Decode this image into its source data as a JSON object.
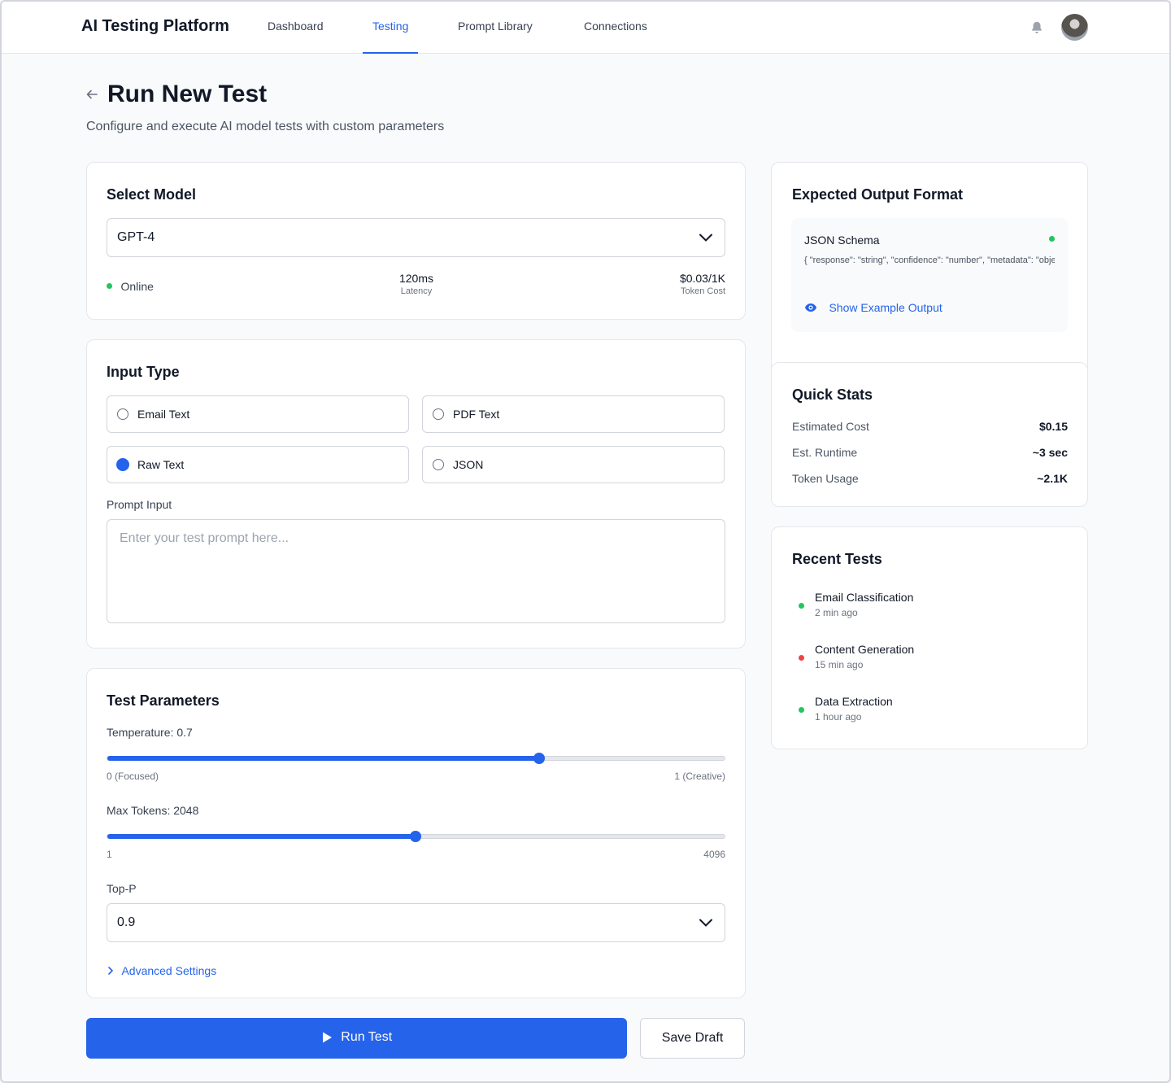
{
  "header": {
    "brand": "AI Testing Platform",
    "nav": [
      {
        "label": "Dashboard"
      },
      {
        "label": "Testing"
      },
      {
        "label": "Prompt Library"
      },
      {
        "label": "Connections"
      }
    ],
    "active_nav": "Testing",
    "notifications_icon": "bell-icon",
    "avatar_icon": "user-avatar"
  },
  "page": {
    "title": "Run New Test",
    "subtitle": "Configure and execute AI model tests with custom parameters",
    "back_icon": "arrow-left-icon"
  },
  "select_model": {
    "title": "Select Model",
    "selected": "GPT-4",
    "status": "Online",
    "status_color": "#22c55e",
    "latency_value": "120ms",
    "latency_label": "Latency",
    "cost_value": "$0.03/1K",
    "cost_label": "Token Cost"
  },
  "input_type": {
    "title": "Input Type",
    "options": [
      {
        "label": "Email Text",
        "checked": false
      },
      {
        "label": "PDF Text",
        "checked": false
      },
      {
        "label": "Raw Text",
        "checked": true
      },
      {
        "label": "JSON",
        "checked": false
      }
    ],
    "prompt_label": "Prompt Input",
    "prompt_placeholder": "Enter your test prompt here...",
    "prompt_value": ""
  },
  "test_parameters": {
    "title": "Test Parameters",
    "temperature": {
      "label": "Temperature: 0.7",
      "value": 0.7,
      "min": 0,
      "max": 1,
      "min_label": "0 (Focused)",
      "max_label": "1 (Creative)"
    },
    "max_tokens": {
      "label": "Max Tokens: 2048",
      "value": 2048,
      "min": 1,
      "max": 4096,
      "min_label": "1",
      "max_label": "4096"
    },
    "top_p": {
      "label": "Top-P",
      "selected": "0.9"
    },
    "advanced_link": "Advanced Settings"
  },
  "actions": {
    "run_label": "Run Test",
    "save_label": "Save Draft",
    "primary_color": "#2563eb"
  },
  "expected_output": {
    "title": "Expected Output Format",
    "schema_title": "JSON Schema",
    "schema_preview": "{ \"response\": \"string\", \"confidence\": \"number\", \"metadata\": \"object\" }",
    "status_color": "#22c55e",
    "show_example_label": "Show Example Output",
    "show_example_icon": "eye-icon"
  },
  "quick_stats": {
    "title": "Quick Stats",
    "rows": [
      {
        "label": "Estimated Cost",
        "value": "$0.15"
      },
      {
        "label": "Est. Runtime",
        "value": "~3 sec"
      },
      {
        "label": "Token Usage",
        "value": "~2.1K"
      }
    ]
  },
  "recent_tests": {
    "title": "Recent Tests",
    "items": [
      {
        "name": "Email Classification",
        "time": "2 min ago",
        "status": "success",
        "color": "#22c55e"
      },
      {
        "name": "Content Generation",
        "time": "15 min ago",
        "status": "failed",
        "color": "#ef4444"
      },
      {
        "name": "Data Extraction",
        "time": "1 hour ago",
        "status": "success",
        "color": "#22c55e"
      }
    ]
  }
}
